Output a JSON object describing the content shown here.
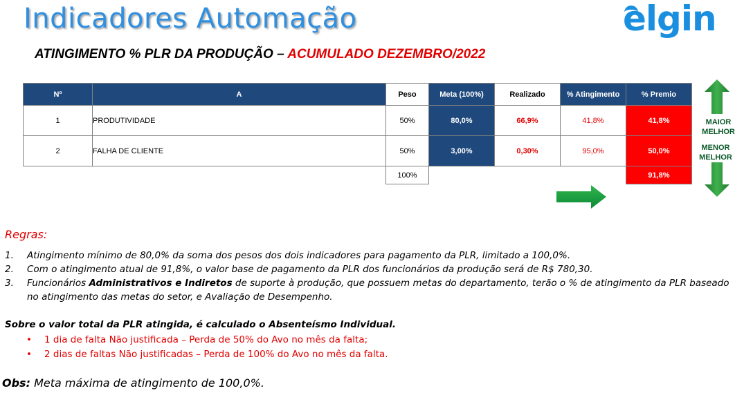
{
  "header": {
    "title": "Indicadores Automação",
    "logo_text": "elgin",
    "subtitle_black": "ATINGIMENTO % PLR DA PRODUÇÃO – ",
    "subtitle_red": "ACUMULADO DEZEMBRO/2022"
  },
  "table": {
    "headers": {
      "n": "Nº",
      "a": "A",
      "peso": "Peso",
      "meta": "Meta (100%)",
      "realizado": "Realizado",
      "atingimento": "% Atingimento",
      "premio": "% Premio"
    },
    "rows": [
      {
        "n": "1",
        "a": "PRODUTIVIDADE",
        "peso": "50%",
        "meta": "80,0%",
        "realizado": "66,9%",
        "atingimento": "41,8%",
        "premio": "41,8%"
      },
      {
        "n": "2",
        "a": "FALHA DE CLIENTE",
        "peso": "50%",
        "meta": "3,00%",
        "realizado": "0,30%",
        "atingimento": "95,0%",
        "premio": "50,0%"
      }
    ],
    "total": {
      "peso": "100%",
      "premio": "91,8%"
    }
  },
  "side_labels": {
    "maior": "MAIOR MELHOR",
    "menor": "MENOR MELHOR"
  },
  "colors": {
    "title_blue": "#2f8fe0",
    "header_navy": "#1f497d",
    "premio_red": "#ff0000",
    "accent_red": "#e00000",
    "arrow_green": "#2e9a3c"
  },
  "icons": {
    "up": "arrow-up-icon",
    "down": "arrow-down-icon",
    "right": "arrow-right-icon"
  },
  "rules": {
    "heading": "Regras:",
    "items": [
      {
        "num": "1.",
        "pre": "Atingimento mínimo de 80,0% da soma dos pesos dos dois indicadores para pagamento da PLR, limitado a 100,0%.",
        "bold": "",
        "post": ""
      },
      {
        "num": "2.",
        "pre": "Com o atingimento atual de 91,8%, o valor base de pagamento da PLR dos funcionários da produção será de R$ 780,30.",
        "bold": "",
        "post": ""
      },
      {
        "num": "3.",
        "pre": "Funcionários ",
        "bold": "Administrativos e Indiretos",
        "post": " de suporte à produção, que possuem metas do departamento, terão o % de atingimento da PLR baseado no atingimento das metas do setor, e Avaliação de Desempenho."
      }
    ]
  },
  "absenteeism": {
    "heading": "Sobre o valor total da PLR atingida, é calculado o Absenteísmo Individual.",
    "bullet": "•",
    "items": [
      "1 dia de falta Não justificada – Perda de 50% do Avo no mês da falta;",
      "2 dias de faltas Não justificadas – Perda de 100% do Avo no mês da falta."
    ]
  },
  "obs": {
    "label": "Obs:",
    "text": " Meta máxima de atingimento de 100,0%."
  }
}
